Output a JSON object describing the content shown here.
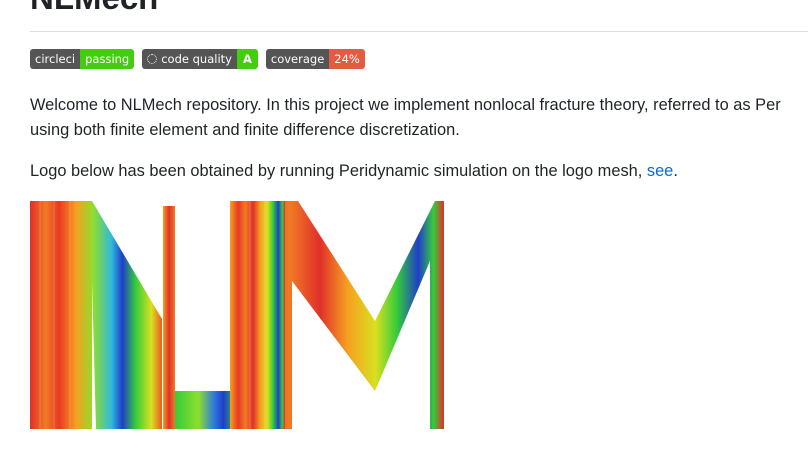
{
  "repo": {
    "title": "NLMech"
  },
  "badges": {
    "circleci": {
      "label": "circleci",
      "value": "passing"
    },
    "code_quality": {
      "label": "code quality",
      "value": "A",
      "icon": "spinner-icon"
    },
    "coverage": {
      "label": "coverage",
      "value": "24%"
    }
  },
  "content": {
    "intro_line1": "Welcome to NLMech repository. In this project we implement nonlocal fracture theory, referred to as Per",
    "intro_line2": "using both finite element and finite difference discretization.",
    "logo_text": "Logo below has been obtained by running Peridynamic simulation on the logo mesh,",
    "logo_link": "see",
    "logo_text_end": "."
  },
  "colors": {
    "badge_left": "#555555",
    "badge_green": "#44cc11",
    "badge_red": "#e05d44",
    "link": "#0969da",
    "heat_hot": "#e0302a",
    "heat_warm": "#f5a020",
    "heat_mid": "#d9e020",
    "heat_cool": "#35cc3a",
    "heat_cold": "#1f3fc8"
  }
}
